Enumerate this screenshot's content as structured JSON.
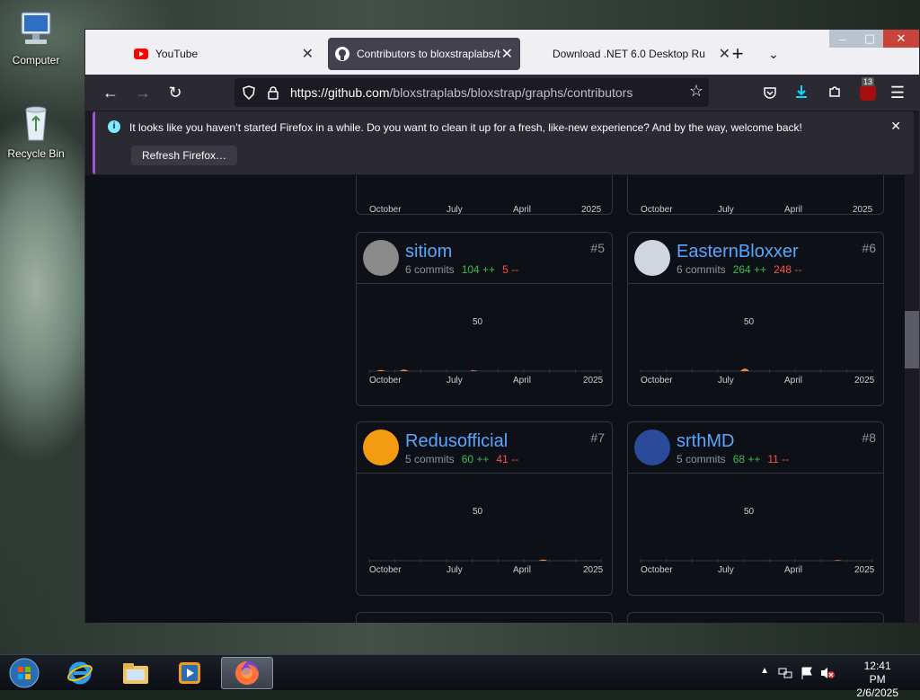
{
  "desktop": {
    "icons": [
      {
        "label": "Computer",
        "icon": "computer-icon"
      },
      {
        "label": "Recycle Bin",
        "icon": "recycle-bin-icon"
      }
    ]
  },
  "browser": {
    "tabs": [
      {
        "label": "YouTube",
        "icon": "youtube-icon",
        "active": false
      },
      {
        "label": "Contributors to bloxstraplabs/b",
        "icon": "github-icon",
        "active": true
      },
      {
        "label": "Download .NET 6.0 Desktop Ru",
        "icon": "",
        "active": false
      }
    ],
    "url_host": "https://github.com",
    "url_path": "/bloxstraplabs/bloxstrap/graphs/contributors",
    "extension_badge": "13",
    "colors": {
      "accent": "#a055d6",
      "download": "#00ddff",
      "link": "#58a6ff",
      "add": "#3fb950",
      "del": "#f85149",
      "spark": "#f0883e"
    }
  },
  "notification": {
    "message": "It looks like you haven’t started Firefox in a while. Do you want to clean it up for a fresh, like-new experience? And by the way, welcome back!",
    "button_label": "Refresh Firefox…"
  },
  "axis_labels": [
    "October",
    "July",
    "April",
    "2025"
  ],
  "y_label": "50",
  "contributors": [
    {
      "username": "sitiom",
      "rank": "#5",
      "commits": "6 commits",
      "additions": "104 ++",
      "deletions": "5 --",
      "avatar_color": "#8a8a8a",
      "spark": [
        0.08,
        0.12,
        0.0,
        0.0,
        0.06,
        0.0,
        0.0,
        0.0,
        0.0,
        0.0
      ]
    },
    {
      "username": "EasternBloxxer",
      "rank": "#6",
      "commits": "6 commits",
      "additions": "264 ++",
      "deletions": "248 --",
      "avatar_color": "#cfd6df",
      "spark": [
        0.0,
        0.0,
        0.0,
        0.0,
        0.18,
        0.0,
        0.0,
        0.0,
        0.0,
        0.0
      ]
    },
    {
      "username": "Redusofficial",
      "rank": "#7",
      "commits": "5 commits",
      "additions": "60 ++",
      "deletions": "41 --",
      "avatar_color": "#f39c12",
      "spark": [
        0.0,
        0.0,
        0.0,
        0.0,
        0.0,
        0.0,
        0.0,
        0.08,
        0.0,
        0.0
      ]
    },
    {
      "username": "srthMD",
      "rank": "#8",
      "commits": "5 commits",
      "additions": "68 ++",
      "deletions": "11 --",
      "avatar_color": "#2a4a9a",
      "spark": [
        0.0,
        0.0,
        0.0,
        0.0,
        0.0,
        0.0,
        0.0,
        0.0,
        0.05,
        0.0
      ]
    }
  ],
  "taskbar": {
    "apps": [
      "start-orb-icon",
      "internet-explorer-icon",
      "file-explorer-icon",
      "media-player-icon",
      "firefox-icon"
    ],
    "time": "12:41 PM",
    "date": "2/6/2025"
  }
}
